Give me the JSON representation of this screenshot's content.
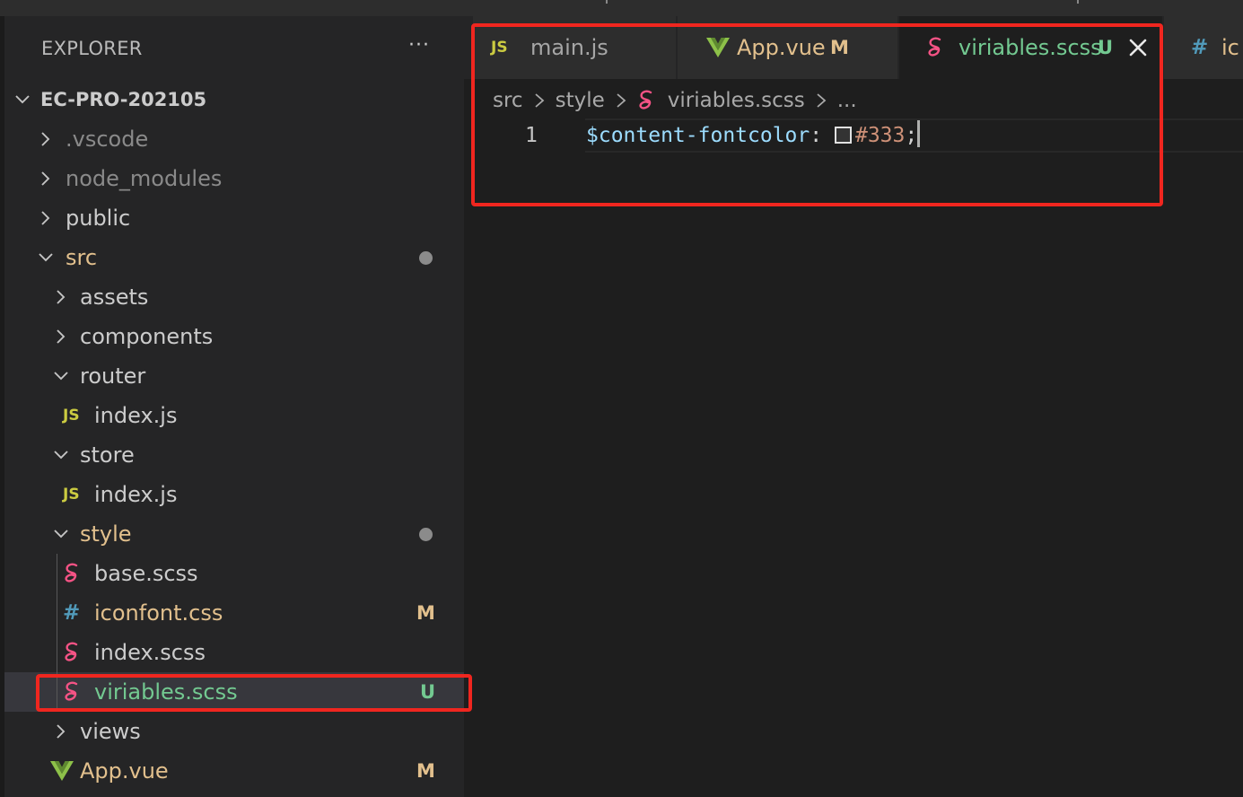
{
  "explorer": {
    "title": "EXPLORER",
    "more_actions": "···",
    "project": "EC-PRO-202105",
    "items": [
      {
        "label": "EC-PRO-202105",
        "type": "folder",
        "expanded": true,
        "depth": 0
      },
      {
        "label": ".vscode",
        "type": "folder",
        "expanded": false,
        "depth": 1,
        "color": "#8a8a8a"
      },
      {
        "label": "node_modules",
        "type": "folder",
        "expanded": false,
        "depth": 1,
        "color": "#8a8a8a"
      },
      {
        "label": "public",
        "type": "folder",
        "expanded": false,
        "depth": 1
      },
      {
        "label": "src",
        "type": "folder",
        "expanded": true,
        "depth": 1,
        "color": "#e2c08d",
        "modified_dot": true
      },
      {
        "label": "assets",
        "type": "folder",
        "expanded": false,
        "depth": 2
      },
      {
        "label": "components",
        "type": "folder",
        "expanded": false,
        "depth": 2
      },
      {
        "label": "router",
        "type": "folder",
        "expanded": true,
        "depth": 2
      },
      {
        "label": "index.js",
        "type": "js",
        "depth": 3
      },
      {
        "label": "store",
        "type": "folder",
        "expanded": true,
        "depth": 2
      },
      {
        "label": "index.js",
        "type": "js",
        "depth": 3
      },
      {
        "label": "style",
        "type": "folder",
        "expanded": true,
        "depth": 2,
        "color": "#e2c08d",
        "modified_dot": true
      },
      {
        "label": "base.scss",
        "type": "scss",
        "depth": 3
      },
      {
        "label": "iconfont.css",
        "type": "css",
        "depth": 3,
        "color": "#e2c08d",
        "badge": "M",
        "badge_color": "#e2c08d"
      },
      {
        "label": "index.scss",
        "type": "scss",
        "depth": 3
      },
      {
        "label": "viriables.scss",
        "type": "scss",
        "depth": 3,
        "color": "#73c991",
        "badge": "U",
        "badge_color": "#73c991",
        "selected": true
      },
      {
        "label": "views",
        "type": "folder",
        "expanded": false,
        "depth": 2
      },
      {
        "label": "App.vue",
        "type": "vue",
        "depth": 2,
        "color": "#e2c08d",
        "badge": "M",
        "badge_color": "#e2c08d"
      }
    ]
  },
  "tabs": [
    {
      "label": "main.js",
      "icon": "js-icon",
      "color": "#a6a6a6"
    },
    {
      "label": "App.vue",
      "icon": "vue-icon",
      "color": "#e2c08d",
      "badge": "M",
      "badge_color": "#e2c08d"
    },
    {
      "label": "viriables.scss",
      "icon": "sass-icon",
      "color": "#73c991",
      "badge": "U",
      "badge_color": "#73c991",
      "active": true
    },
    {
      "label": "ic",
      "icon": "css-hash-icon",
      "color": "#e2c08d"
    }
  ],
  "breadcrumb": [
    "src",
    "style",
    "viriables.scss",
    "..."
  ],
  "editor": {
    "line_number": "1",
    "tokens": {
      "variable": "$content-fontcolor",
      "colon": ":",
      "value": "#333",
      "semicolon": ";"
    },
    "swatch_color": "#333333"
  },
  "colors": {
    "highlight_box": "#f0261f",
    "sass_pink": "#f55385",
    "vue_green": "#8dc149",
    "js_yellow": "#cbcb41",
    "css_blue": "#519aba"
  }
}
